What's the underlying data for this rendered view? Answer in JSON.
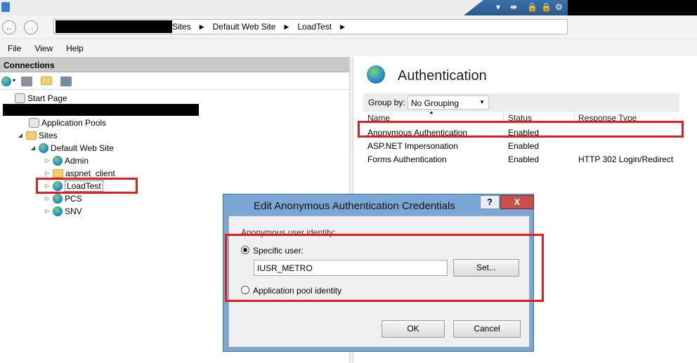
{
  "window": {
    "address_crumbs": [
      "Sites",
      "Default Web Site",
      "LoadTest"
    ]
  },
  "menu": [
    "File",
    "View",
    "Help"
  ],
  "connections": {
    "header": "Connections",
    "tree": [
      {
        "label": "Start Page"
      },
      {
        "label": "Application Pools"
      },
      {
        "label": "Sites"
      },
      {
        "label": "Default Web Site"
      },
      {
        "label": "Admin"
      },
      {
        "label": "aspnet_client"
      },
      {
        "label": "LoadTest"
      },
      {
        "label": "PCS"
      },
      {
        "label": "SNV"
      }
    ]
  },
  "auth": {
    "title": "Authentication",
    "group_by_label": "Group by:",
    "group_by_value": "No Grouping",
    "columns": [
      "Name",
      "Status",
      "Response Type"
    ],
    "rows": [
      {
        "name": "Anonymous Authentication",
        "status": "Enabled",
        "response": ""
      },
      {
        "name": "ASP.NET Impersonation",
        "status": "Enabled",
        "response": ""
      },
      {
        "name": "Forms Authentication",
        "status": "Enabled",
        "response": "HTTP 302 Login/Redirect"
      }
    ]
  },
  "dialog": {
    "title": "Edit Anonymous Authentication Credentials",
    "help": "?",
    "close": "X",
    "group_label": "Anonymous user identity:",
    "specific_user_label": "Specific user:",
    "specific_user_value": "IUSR_METRO",
    "set_button": "Set...",
    "app_pool_label": "Application pool identity",
    "ok": "OK",
    "cancel": "Cancel"
  },
  "colors": {
    "highlight": "#e02020",
    "dialog_frame": "#7aa7d6",
    "close": "#c7504a"
  }
}
